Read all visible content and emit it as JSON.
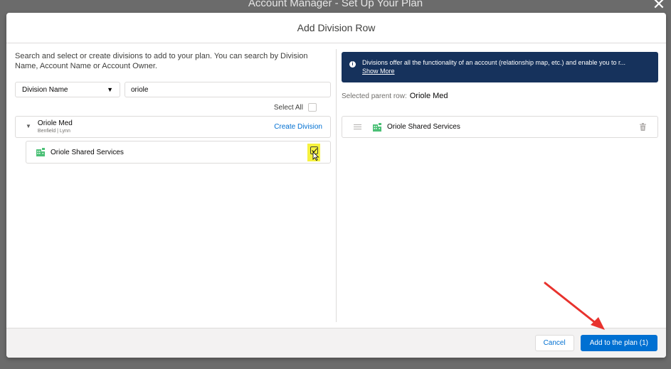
{
  "backdrop": {
    "title": "Account Manager - Set Up Your Plan",
    "close_glyph": "✕"
  },
  "modal": {
    "title": "Add Division Row"
  },
  "left": {
    "instructions": "Search and select or create divisions to add to your plan. You can search by Division Name, Account Name or Account Owner.",
    "search_field": {
      "selected": "Division Name",
      "caret": "▼",
      "value": "oriole"
    },
    "select_all_label": "Select All",
    "parent_row": {
      "toggle": "▼",
      "name": "Oriole Med",
      "meta": "Benfield | Lynn",
      "create_label": "Create Division"
    },
    "child_row": {
      "name": "Oriole Shared Services",
      "checked": true
    }
  },
  "right": {
    "banner": {
      "icon": "i",
      "text": "Divisions offer all the functionality of an account (relationship map, etc.) and enable you to r...",
      "link": "Show More"
    },
    "parent_label": "Selected parent row:",
    "parent_value": "Oriole Med",
    "selected_rows": [
      {
        "name": "Oriole Shared Services"
      }
    ]
  },
  "footer": {
    "cancel_label": "Cancel",
    "add_label": "Add to the plan (1)"
  },
  "colors": {
    "brand": "#0070d2",
    "banner": "#16325c",
    "highlight": "#f6f23f",
    "annotation": "#e8322d",
    "account_icon": "#4bc076"
  },
  "icons": [
    "info-icon",
    "account-icon",
    "drag-handle-icon",
    "trash-icon",
    "cursor-icon",
    "close-icon",
    "caret-down-icon",
    "annotation-arrow"
  ]
}
